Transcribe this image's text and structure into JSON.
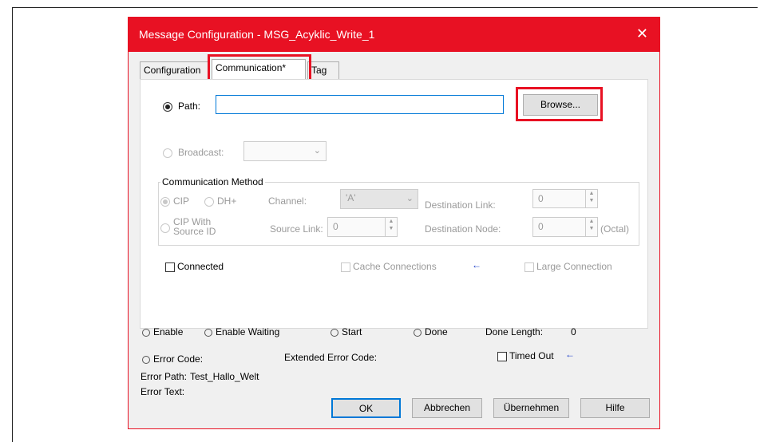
{
  "dialog": {
    "title": "Message Configuration - MSG_Acyklic_Write_1",
    "close_glyph": "✕"
  },
  "tabs": [
    {
      "label": "Configuration"
    },
    {
      "label": "Communication*"
    },
    {
      "label": "Tag"
    }
  ],
  "path": {
    "label": "Path:",
    "value": "",
    "browse_label": "Browse..."
  },
  "broadcast": {
    "label": "Broadcast:",
    "value": ""
  },
  "comm_method": {
    "group_label": "Communication Method",
    "cip_label": "CIP",
    "dhplus_label": "DH+",
    "channel_label": "Channel:",
    "channel_value": "'A'",
    "dest_link_label": "Destination Link:",
    "dest_link_value": "0",
    "cip_with_source_line1": "CIP With",
    "cip_with_source_line2": "Source ID",
    "source_link_label": "Source Link:",
    "source_link_value": "0",
    "dest_node_label": "Destination Node:",
    "dest_node_value": "0",
    "octal_label": "(Octal)"
  },
  "options": {
    "connected_label": "Connected",
    "cache_label": "Cache Connections",
    "large_label": "Large Connection",
    "arrow_glyph": "←"
  },
  "status": {
    "enable": "Enable",
    "enable_waiting": "Enable Waiting",
    "start": "Start",
    "done": "Done",
    "done_length_label": "Done Length:",
    "done_length_value": "0",
    "error_code": "Error Code:",
    "extended_error_code": "Extended Error Code:",
    "timed_out": "Timed Out",
    "error_path_label": "Error Path:",
    "error_path_value": "Test_Hallo_Welt",
    "error_text_label": "Error Text:"
  },
  "buttons": {
    "ok": "OK",
    "cancel": "Abbrechen",
    "apply": "Übernehmen",
    "help": "Hilfe"
  },
  "colors": {
    "accent": "#e81123",
    "arrow": "#1a3cc8"
  }
}
